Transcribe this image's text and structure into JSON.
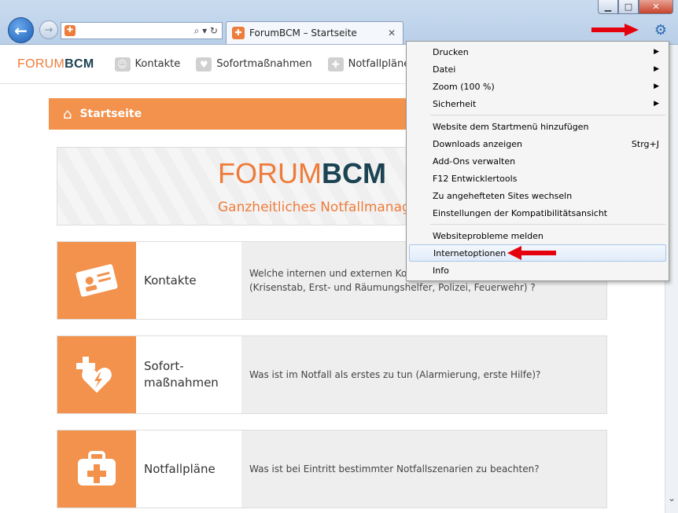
{
  "window": {
    "min_label": "▁",
    "max_label": "□",
    "close_label": "✕"
  },
  "toolbar": {
    "address_value": "",
    "address_icons": "⌕ ▾ ↻",
    "tab_title": "ForumBCM – Startseite",
    "tab_close": "✕"
  },
  "site": {
    "logo_forum": "FORUM",
    "logo_bcm": "BCM",
    "menu": [
      {
        "label": "Kontakte"
      },
      {
        "label": "Sofortmaßnahmen"
      },
      {
        "label": "Notfallpläne"
      }
    ],
    "start_label": "Startseite",
    "banner_forum": "FORUM",
    "banner_bcm": "BCM",
    "banner_sub": "Ganzheitliches Notfallmanag",
    "cards": [
      {
        "title": "Kontakte",
        "title2": "",
        "desc": "Welche internen und externen Kon",
        "desc2": "(Krisenstab, Erst- und Räumungshelfer, Polizei, Feuerwehr) ?"
      },
      {
        "title": "Sofort-",
        "title2": "maßnahmen",
        "desc": "Was ist im Notfall als erstes zu tun (Alarmierung, erste Hilfe)?",
        "desc2": ""
      },
      {
        "title": "Notfallpläne",
        "title2": "",
        "desc": "Was ist bei Eintritt bestimmter Notfallszenarien zu beachten?",
        "desc2": ""
      }
    ]
  },
  "menu_dropdown": {
    "items": [
      {
        "label": "Drucken",
        "arrow": "▶"
      },
      {
        "label": "Datei",
        "arrow": "▶"
      },
      {
        "label": "Zoom (100 %)",
        "arrow": "▶"
      },
      {
        "label": "Sicherheit",
        "arrow": "▶"
      },
      {
        "label": "Website dem Startmenü hinzufügen"
      },
      {
        "label": "Downloads anzeigen",
        "shortcut": "Strg+J"
      },
      {
        "label": "Add-Ons verwalten"
      },
      {
        "label": "F12 Entwicklertools"
      },
      {
        "label": "Zu angehefteten Sites wechseln"
      },
      {
        "label": "Einstellungen der Kompatibilitätsansicht"
      },
      {
        "label": "Websiteprobleme melden"
      },
      {
        "label": "Internetoptionen"
      },
      {
        "label": "Info"
      }
    ]
  },
  "colors": {
    "accent_orange": "#f2924d",
    "brand_dark": "#1b4352",
    "annotation_red": "#e5000e"
  }
}
